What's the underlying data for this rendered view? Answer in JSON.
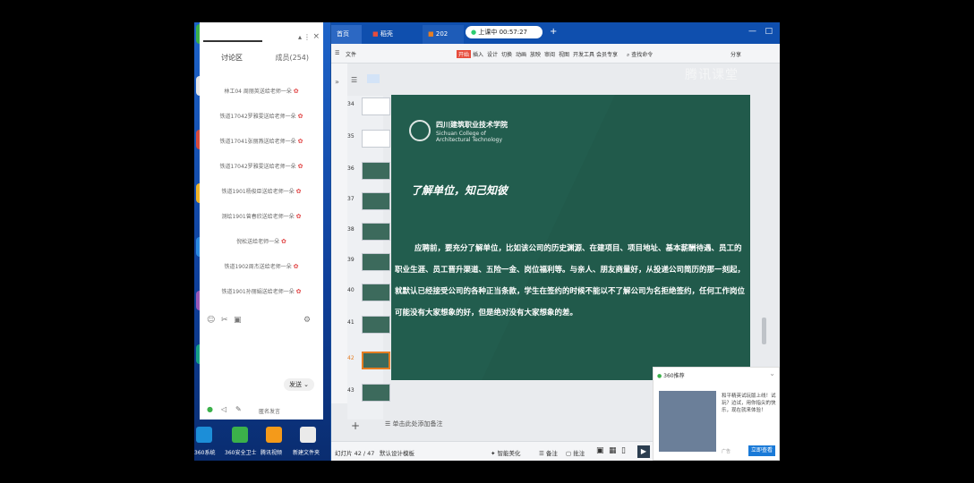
{
  "chat": {
    "title": "讨论区",
    "members": "成员(254)",
    "messages": [
      "林工04 周丽英送给老师一朵",
      "铁道17042罗雅雯送给老师一朵",
      "铁道17041张丽燕送给老师一朵",
      "铁道17042罗雅雯送给老师一朵",
      "铁道1901杨俊臣送给老师一朵",
      "测绘1901曾春欣送给老师一朵",
      "倪松送给老师一朵",
      "铁道1902周杰送给老师一朵",
      "铁道1901孙丽娟送给老师一朵"
    ],
    "send_label": "发送",
    "bottom_status": "匿名发言"
  },
  "desktop": {
    "taskbar_labels": [
      "360系统",
      "360安全卫士",
      "腾讯视频",
      "新建文件夹"
    ]
  },
  "wps": {
    "tabs": [
      "首页",
      "稻壳",
      "202",
      "上课中 00:57:27"
    ],
    "ribbon": [
      "文件",
      "开始",
      "插入",
      "设计",
      "切换",
      "动画",
      "放映",
      "审阅",
      "视图",
      "开发工具",
      "会员专享",
      "查找命令"
    ],
    "share_label": "分享",
    "thumb_numbers": [
      "34",
      "35",
      "36",
      "37",
      "38",
      "39",
      "40",
      "41",
      "42",
      "43"
    ],
    "notes_placeholder": "单击此处添加备注",
    "status": {
      "page": "幻灯片 42 / 47",
      "template": "默认设计模板",
      "beautify": "智能美化",
      "notes": "备注",
      "comments": "批注"
    }
  },
  "slide": {
    "school_cn": "四川建筑职业技术学院",
    "school_en": "Sichuan College of Architectural Technology",
    "heading": "了解单位，知己知彼",
    "body": "应聘前，要充分了解单位，比如该公司的历史渊源、在建项目、项目地址、基本薪酬待遇、员工的职业生涯、员工晋升渠道、五险一金、岗位福利等。与亲人、朋友商量好，从投递公司简历的那一刻起，就默认已经接受公司的各种正当条款，学生在签约的时候不能以不了解公司为名拒绝签约，任何工作岗位可能没有大家想象的好，但是绝对没有大家想象的差。"
  },
  "popup": {
    "title": "360推荐",
    "text": "和平精英试玩版上线！试玩？边试，用你指尖的快乐，现在就来体验！",
    "ad": "广告",
    "button": "立即查看"
  },
  "watermark": "腾讯课堂"
}
